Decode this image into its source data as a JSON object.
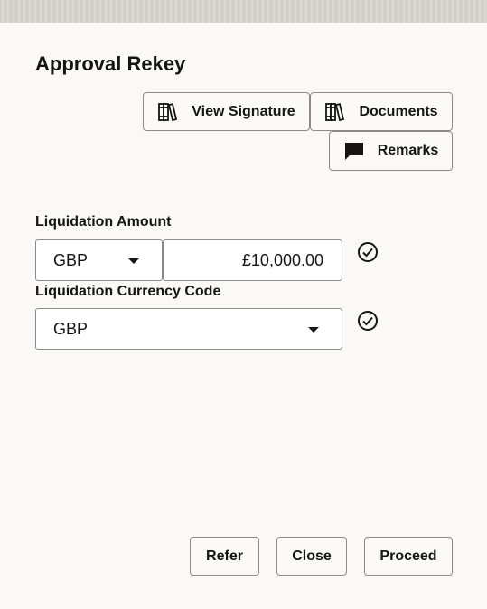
{
  "dialog": {
    "title": "Approval Rekey"
  },
  "toolbar": {
    "view_signature_label": "View Signature",
    "view_signature_icon": "books-icon",
    "documents_label": "Documents",
    "documents_icon": "books-icon",
    "remarks_label": "Remarks",
    "remarks_icon": "speech-bubble-icon"
  },
  "form": {
    "liquidation_amount": {
      "label": "Liquidation Amount",
      "currency": "GBP",
      "amount": "£10,000.00",
      "status_icon": "check-circle-icon"
    },
    "liquidation_currency_code": {
      "label": "Liquidation Currency Code",
      "value": "GBP",
      "status_icon": "check-circle-icon"
    }
  },
  "footer": {
    "refer_label": "Refer",
    "close_label": "Close",
    "proceed_label": "Proceed"
  },
  "colors": {
    "text": "#161513",
    "border": "#8e8a84",
    "background": "#faf9f7"
  }
}
